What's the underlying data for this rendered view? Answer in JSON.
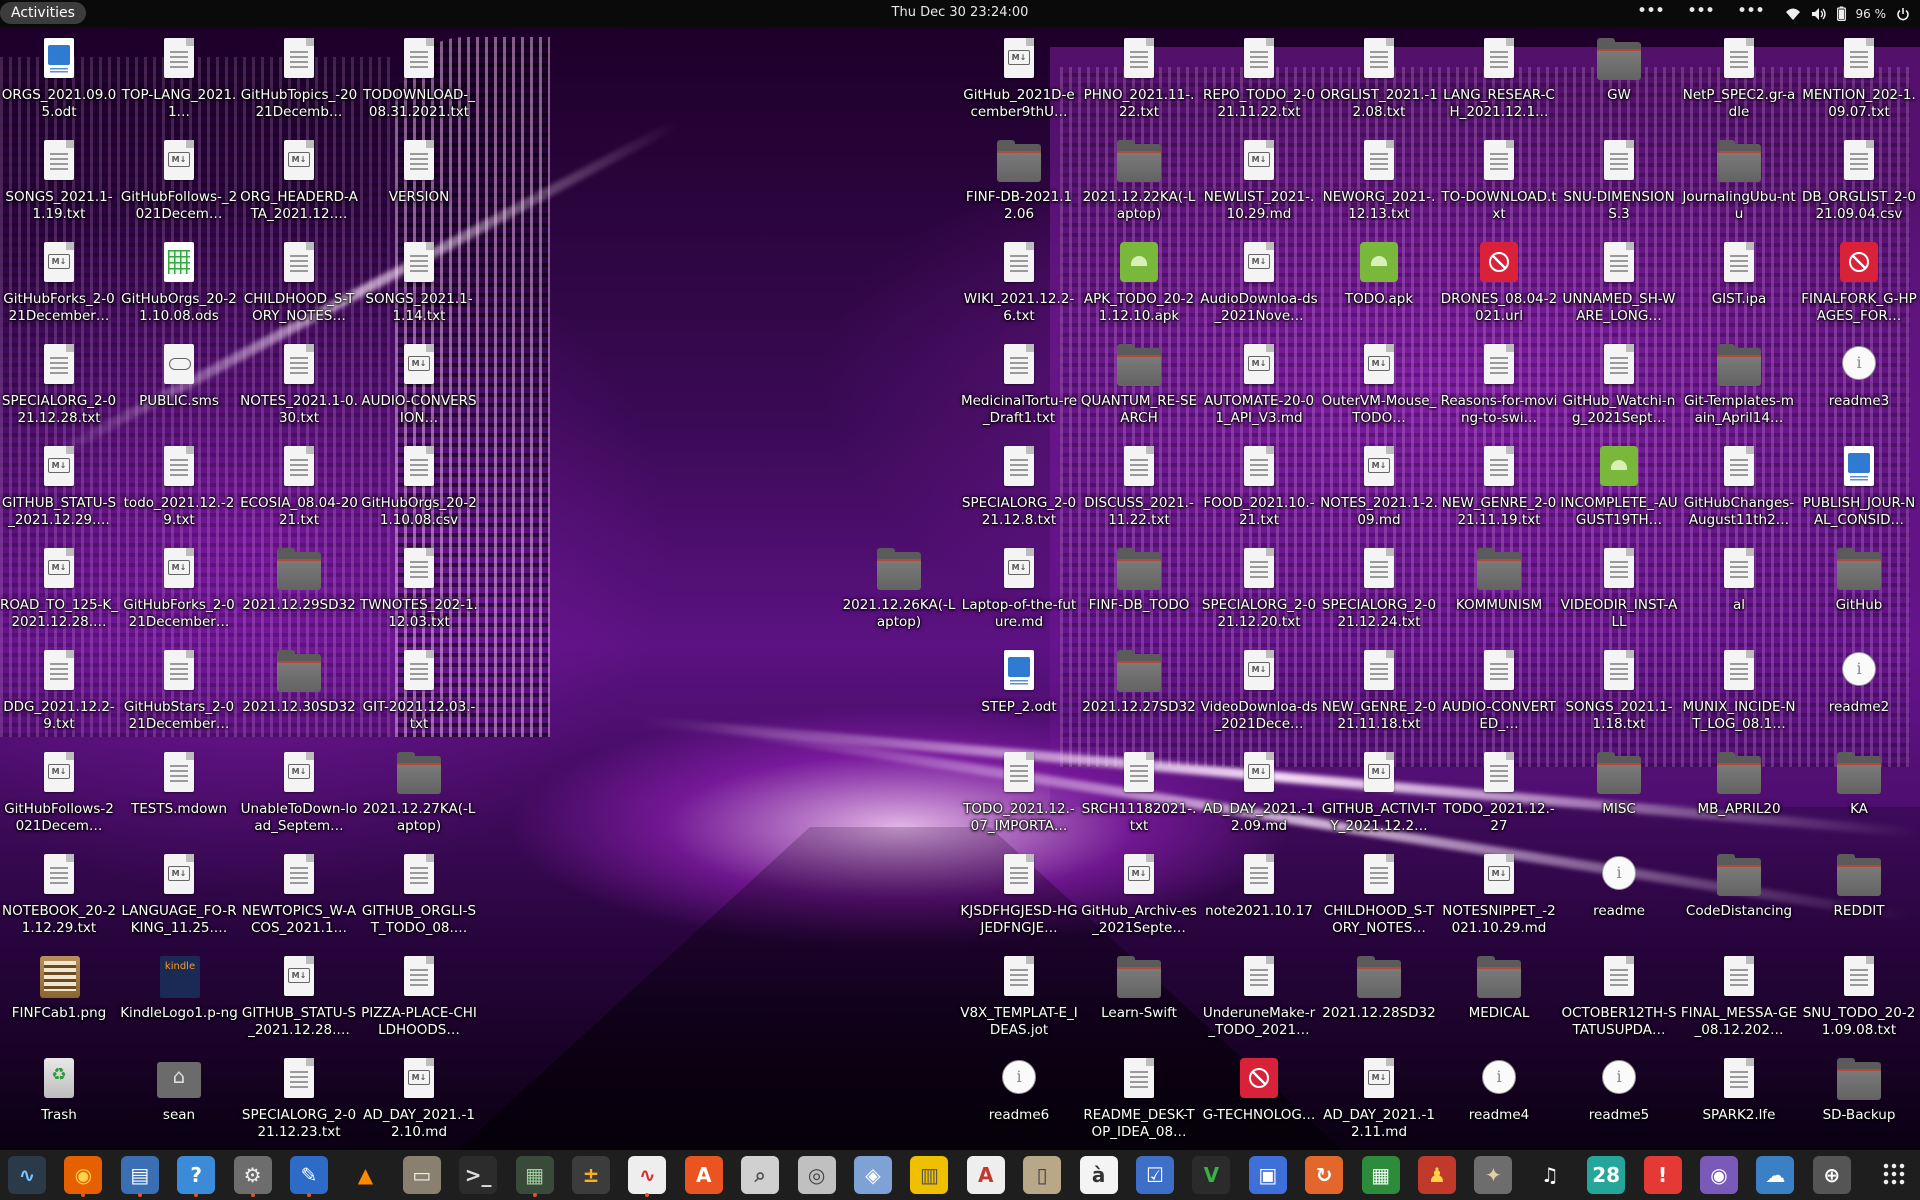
{
  "topbar": {
    "activities": "Activities",
    "clock": "Thu Dec 30  23:24:00",
    "dots": [
      "•••",
      "•••",
      "•••"
    ],
    "battery": "96 %"
  },
  "columns_left": [
    [
      {
        "label": "ORGS_2021.09.​05.odt",
        "type": "odt"
      },
      {
        "label": "SONGS_2021.1-​1.19.txt",
        "type": "doc"
      },
      {
        "label": "GitHubForks_2-​021December…",
        "type": "md"
      },
      {
        "label": "SPECIALORG_2-​021.12.28.txt",
        "type": "doc"
      },
      {
        "label": "GITHUB_STATU-​S_2021.12.29.…",
        "type": "md"
      },
      {
        "label": "ROAD_TO_125-​K_2021.12.28.…",
        "type": "md"
      },
      {
        "label": "DDG_2021.12.2-​9.txt",
        "type": "doc"
      },
      {
        "label": "GitHubFollows-​2021Decem…",
        "type": "md"
      },
      {
        "label": "NOTEBOOK_20-​21.12.29.txt",
        "type": "doc"
      },
      {
        "label": "FINFCab1.png",
        "type": "img-cab"
      },
      {
        "label": "Trash",
        "type": "trash"
      }
    ],
    [
      {
        "label": "TOP-​LANG_2021.1…",
        "type": "doc"
      },
      {
        "label": "GitHubFollows-​_2021Decem…",
        "type": "md"
      },
      {
        "label": "GitHubOrgs_20-​21.10.08.ods",
        "type": "ods"
      },
      {
        "label": "PUBLIC.sms",
        "type": "game"
      },
      {
        "label": "todo_2021.12.-​29.txt",
        "type": "doc"
      },
      {
        "label": "GitHubForks_2-​021December…",
        "type": "md"
      },
      {
        "label": "GitHubStars_2-​021December…",
        "type": "doc"
      },
      {
        "label": "TESTS.mdown",
        "type": "doc"
      },
      {
        "label": "LANGUAGE_FO-​RKING_11.25.…",
        "type": "md"
      },
      {
        "label": "KindleLogo1.p-​ng",
        "type": "img-kindle"
      },
      {
        "label": "sean",
        "type": "home"
      }
    ],
    [
      {
        "label": "GitHubTopics_-​2021Decemb…",
        "type": "doc"
      },
      {
        "label": "ORG_HEADERD-​ATA_2021.12.…",
        "type": "md"
      },
      {
        "label": "CHILDHOOD_S-​TORY_NOTES…",
        "type": "doc"
      },
      {
        "label": "NOTES_2021.1-​0.30.txt",
        "type": "doc"
      },
      {
        "label": "ECOSIA_08.04-​2021.txt",
        "type": "doc"
      },
      {
        "label": "2021.12.29SD32",
        "type": "folder"
      },
      {
        "label": "2021.12.30SD32",
        "type": "folder"
      },
      {
        "label": "UnableToDown-​load_Septem…",
        "type": "md"
      },
      {
        "label": "NEWTOPICS_W-​ACOS_2021.1…",
        "type": "doc"
      },
      {
        "label": "GITHUB_STATU-​S_2021.12.28.…",
        "type": "md"
      },
      {
        "label": "SPECIALORG_2-​021.12.23.txt",
        "type": "doc"
      }
    ],
    [
      {
        "label": "TODOWNLOAD-​_08.31.2021.txt",
        "type": "doc"
      },
      {
        "label": "VERSION",
        "type": "doc"
      },
      {
        "label": "SONGS_2021.1-​1.14.txt",
        "type": "doc"
      },
      {
        "label": "AUDIO-​CONVERSION…",
        "type": "md"
      },
      {
        "label": "GitHubOrgs_20-​21.10.08.csv",
        "type": "doc"
      },
      {
        "label": "TWNOTES_202-​1.12.03.txt",
        "type": "doc"
      },
      {
        "label": "GIT-2021.12.03.-​txt",
        "type": "doc"
      },
      {
        "label": "2021.12.27KA(-​Laptop)",
        "type": "folder"
      },
      {
        "label": "GITHUB_ORGLI-​ST_TODO_08.…",
        "type": "doc"
      },
      {
        "label": "PIZZA-PLACE-​CHILDHOODS…",
        "type": "doc"
      },
      {
        "label": "AD_DAY_2021.-​12.10.md",
        "type": "md"
      }
    ]
  ],
  "lone_icon": {
    "label": "2021.12.26KA(-​Laptop)",
    "type": "folder"
  },
  "columns_right": [
    [
      {
        "label": "GitHub_2021D-​ecember9thU…",
        "type": "md"
      },
      {
        "label": "FINF-​DB-2021.12.06",
        "type": "folder"
      },
      {
        "label": "WIKI_2021.12.2-​6.txt",
        "type": "doc"
      },
      {
        "label": "MedicinalTortu-​re_Draft1.txt",
        "type": "doc"
      },
      {
        "label": "SPECIALORG_2-​021.12.8.txt",
        "type": "doc"
      },
      {
        "label": "Laptop-of-the-​future.md",
        "type": "md"
      },
      {
        "label": "STEP_2.odt",
        "type": "odt"
      },
      {
        "label": "TODO_2021.12.-​07_IMPORTA…",
        "type": "doc"
      },
      {
        "label": "KJSDFHGJESD-​HGJEDFNGJE…",
        "type": "doc"
      },
      {
        "label": "V8X_TEMPLAT-​E_IDEAS.jot",
        "type": "doc"
      },
      {
        "label": "readme6",
        "type": "info"
      }
    ],
    [
      {
        "label": "PHNO_2021.11-​.22.txt",
        "type": "doc"
      },
      {
        "label": "2021.12.22KA(-​Laptop)",
        "type": "folder"
      },
      {
        "label": "APK_TODO_20-​21.12.10.apk",
        "type": "apk"
      },
      {
        "label": "QUANTUM_RE-​SEARCH",
        "type": "folder"
      },
      {
        "label": "DISCUSS_2021.-​11.22.txt",
        "type": "doc"
      },
      {
        "label": "FINF-DB_TODO",
        "type": "folder"
      },
      {
        "label": "2021.12.27SD32",
        "type": "folder"
      },
      {
        "label": "SRCH1118202​1-​.txt",
        "type": "doc"
      },
      {
        "label": "GitHub_Archiv-​es_2021Septe…",
        "type": "md"
      },
      {
        "label": "Learn-Swift",
        "type": "folder"
      },
      {
        "label": "README_DESK-​TOP_IDEA_08…",
        "type": "doc"
      }
    ],
    [
      {
        "label": "REPO_TODO_2-​021.11.22.txt",
        "type": "doc"
      },
      {
        "label": "NEWLIST_2021-​.10.29.md",
        "type": "md"
      },
      {
        "label": "AudioDownloa-​ds_2021Nove…",
        "type": "md"
      },
      {
        "label": "AUTOMATE-20-​01_API_V3.md",
        "type": "md"
      },
      {
        "label": "FOOD_2021.10.-​21.txt",
        "type": "doc"
      },
      {
        "label": "SPECIALORG_2-​021.12.20.txt",
        "type": "doc"
      },
      {
        "label": "VideoDownloa-​ds_2021Dece…",
        "type": "md"
      },
      {
        "label": "AD_DAY_2021.-​12.09.md",
        "type": "md"
      },
      {
        "label": "note2021.10.17",
        "type": "doc"
      },
      {
        "label": "UnderuneMake-​r_TODO_2021…",
        "type": "doc"
      },
      {
        "label": "G-​TECHNOLOG…",
        "type": "blocked"
      }
    ],
    [
      {
        "label": "ORGLIST_2021.-​12.08.txt",
        "type": "doc"
      },
      {
        "label": "NEWORG_2021-​.12.13.txt",
        "type": "doc"
      },
      {
        "label": "TODO.apk",
        "type": "apk"
      },
      {
        "label": "OuterVM-​Mouse_TODO…",
        "type": "md"
      },
      {
        "label": "NOTES_2021.1-​2.09.md",
        "type": "md"
      },
      {
        "label": "SPECIALORG_2-​021.12.24.txt",
        "type": "doc"
      },
      {
        "label": "NEW_GENRE_2-​021.11.18.txt",
        "type": "doc"
      },
      {
        "label": "GITHUB_ACTIVI-​TY_2021.12.2…",
        "type": "md"
      },
      {
        "label": "CHILDHOOD_S-​TORY_NOTES…",
        "type": "doc"
      },
      {
        "label": "2021.12.28SD32",
        "type": "folder"
      },
      {
        "label": "AD_DAY_2021.-​12.11.md",
        "type": "md"
      }
    ],
    [
      {
        "label": "LANG_RESEAR-​CH_2021.12.1…",
        "type": "doc"
      },
      {
        "label": "TO-​DOWNLOAD.txt",
        "type": "doc"
      },
      {
        "label": "DRONES_08.04-​2021.url",
        "type": "blocked"
      },
      {
        "label": "Reasons-for-​moving-to-swi…",
        "type": "doc"
      },
      {
        "label": "NEW_GENRE_2-​021.11.19.txt",
        "type": "doc"
      },
      {
        "label": "KOMMUNISM",
        "type": "folder"
      },
      {
        "label": "AUDIO-​CONVERTED_…",
        "type": "doc"
      },
      {
        "label": "TODO_2021.12.-​27",
        "type": "doc"
      },
      {
        "label": "NOTESNIPPET_-​2021.10.29.md",
        "type": "md"
      },
      {
        "label": "MEDICAL",
        "type": "folder"
      },
      {
        "label": "readme4",
        "type": "info"
      }
    ],
    [
      {
        "label": "GW",
        "type": "folder"
      },
      {
        "label": "SNU-​DIMENSIONS.3",
        "type": "doc"
      },
      {
        "label": "UNNAMED_SH-​WARE_LONG…",
        "type": "doc"
      },
      {
        "label": "GitHub_Watchi-​ng_2021Sept…",
        "type": "doc"
      },
      {
        "label": "INCOMPLETE_-​AUGUST19TH…",
        "type": "apk"
      },
      {
        "label": "VIDEODIR_INST-​ALL",
        "type": "doc"
      },
      {
        "label": "SONGS_2021.1-​1.18.txt",
        "type": "doc"
      },
      {
        "label": "MISC",
        "type": "folder"
      },
      {
        "label": "readme",
        "type": "info"
      },
      {
        "label": "OCTOBER12TH-​STATUSUPDA…",
        "type": "doc"
      },
      {
        "label": "readme5",
        "type": "info"
      }
    ],
    [
      {
        "label": "NetP_SPEC2.gr-​adle",
        "type": "doc"
      },
      {
        "label": "JournalingUbu-​ntu",
        "type": "folder"
      },
      {
        "label": "GIST.ipa",
        "type": "doc"
      },
      {
        "label": "Git-Templates-​main_April14…",
        "type": "folder"
      },
      {
        "label": "GitHubChanges-​August11th2…",
        "type": "doc"
      },
      {
        "label": "al",
        "type": "doc"
      },
      {
        "label": "MUNIX_INCIDE-​NT_LOG_08.1…",
        "type": "doc"
      },
      {
        "label": "MB_APRIL20",
        "type": "folder"
      },
      {
        "label": "CodeDistancing",
        "type": "folder"
      },
      {
        "label": "FINAL_MESSA-​GE_08.12.202…",
        "type": "doc"
      },
      {
        "label": "SPARK2.lfe",
        "type": "doc"
      }
    ],
    [
      {
        "label": "MENTION_202-​1.09.07.txt",
        "type": "doc"
      },
      {
        "label": "DB_ORGLIST_2-​021.09.04.csv",
        "type": "doc"
      },
      {
        "label": "FINALFORK_G-​HPAGES_FOR…",
        "type": "blocked"
      },
      {
        "label": "readme3",
        "type": "info"
      },
      {
        "label": "PUBLISH_JOUR-​NAL_CONSID…",
        "type": "odt"
      },
      {
        "label": "GitHub",
        "type": "folder"
      },
      {
        "label": "readme2",
        "type": "info"
      },
      {
        "label": "KA",
        "type": "folder"
      },
      {
        "label": "REDDIT",
        "type": "folder"
      },
      {
        "label": "SNU_TODO_20-​21.09.08.txt",
        "type": "doc"
      },
      {
        "label": "SD-Backup",
        "type": "folder"
      }
    ]
  ],
  "dock": [
    {
      "name": "system-monitor",
      "color": "#2a3a48",
      "glyph": "∿",
      "fg": "#7ec3ff"
    },
    {
      "name": "firefox",
      "color": "#e66000",
      "glyph": "◉",
      "fg": "#ffd24a"
    },
    {
      "name": "text-document",
      "color": "#3b6fb3",
      "glyph": "▤",
      "fg": "#fff"
    },
    {
      "name": "help",
      "color": "#3c8bd9",
      "glyph": "?",
      "fg": "#fff"
    },
    {
      "name": "settings",
      "color": "#6d6d6d",
      "glyph": "⚙",
      "fg": "#eee"
    },
    {
      "name": "text-editor",
      "color": "#2e6bc7",
      "glyph": "✎",
      "fg": "#fff"
    },
    {
      "name": "vlc",
      "color": "#1e1e1e",
      "glyph": "▲",
      "fg": "#ff8800"
    },
    {
      "name": "files",
      "color": "#8a8070",
      "glyph": "▭",
      "fg": "#eee"
    },
    {
      "name": "terminal",
      "color": "#2c2c2c",
      "glyph": ">_",
      "fg": "#ddd"
    },
    {
      "name": "boxes",
      "color": "#3a4a3a",
      "glyph": "▦",
      "fg": "#9fd19f"
    },
    {
      "name": "calculator",
      "color": "#3c3c3c",
      "glyph": "±",
      "fg": "#ffb020"
    },
    {
      "name": "graph-app",
      "color": "#eeeeee",
      "glyph": "∿",
      "fg": "#d03030"
    },
    {
      "name": "software-center",
      "color": "#e95420",
      "glyph": "A",
      "fg": "#fff"
    },
    {
      "name": "image-viewer",
      "color": "#d0d0d0",
      "glyph": "⌕",
      "fg": "#555"
    },
    {
      "name": "disk-utility",
      "color": "#c0c0c0",
      "glyph": "◎",
      "fg": "#444"
    },
    {
      "name": "scanner",
      "color": "#7ea2d6",
      "glyph": "◈",
      "fg": "#fff"
    },
    {
      "name": "notes",
      "color": "#f0c000",
      "glyph": "▥",
      "fg": "#555"
    },
    {
      "name": "pdf-reader",
      "color": "#eeeeee",
      "glyph": "A",
      "fg": "#c0392b"
    },
    {
      "name": "archive-manager",
      "color": "#b8a888",
      "glyph": "▯",
      "fg": "#444"
    },
    {
      "name": "character-map",
      "color": "#f4f4f4",
      "glyph": "à",
      "fg": "#333"
    },
    {
      "name": "todo",
      "color": "#3d6fc9",
      "glyph": "☑",
      "fg": "#fff"
    },
    {
      "name": "vim",
      "color": "#2b2b2b",
      "glyph": "V",
      "fg": "#3cb043"
    },
    {
      "name": "remote-desktop",
      "color": "#3f6fd8",
      "glyph": "▣",
      "fg": "#fff"
    },
    {
      "name": "backups",
      "color": "#e3662a",
      "glyph": "↻",
      "fg": "#fff"
    },
    {
      "name": "spreadsheet",
      "color": "#2d8c3c",
      "glyph": "▦",
      "fg": "#fff"
    },
    {
      "name": "game-mario",
      "color": "#c0392b",
      "glyph": "♟",
      "fg": "#ffd24a"
    },
    {
      "name": "gimp",
      "color": "#6d6d6d",
      "glyph": "✦",
      "fg": "#e0d0a0"
    },
    {
      "name": "music",
      "color": "#1e1e1e",
      "glyph": "♫",
      "fg": "#fff"
    },
    {
      "name": "calendar",
      "color": "#26a69a",
      "glyph": "28",
      "fg": "#fff"
    },
    {
      "name": "alert-app",
      "color": "#e53935",
      "glyph": "!",
      "fg": "#fff"
    },
    {
      "name": "screenshot",
      "color": "#7a5ab8",
      "glyph": "◉",
      "fg": "#fff"
    },
    {
      "name": "weather",
      "color": "#3b7fc4",
      "glyph": "☁",
      "fg": "#fff"
    },
    {
      "name": "startup-disk",
      "color": "#555555",
      "glyph": "⊕",
      "fg": "#fff"
    }
  ]
}
